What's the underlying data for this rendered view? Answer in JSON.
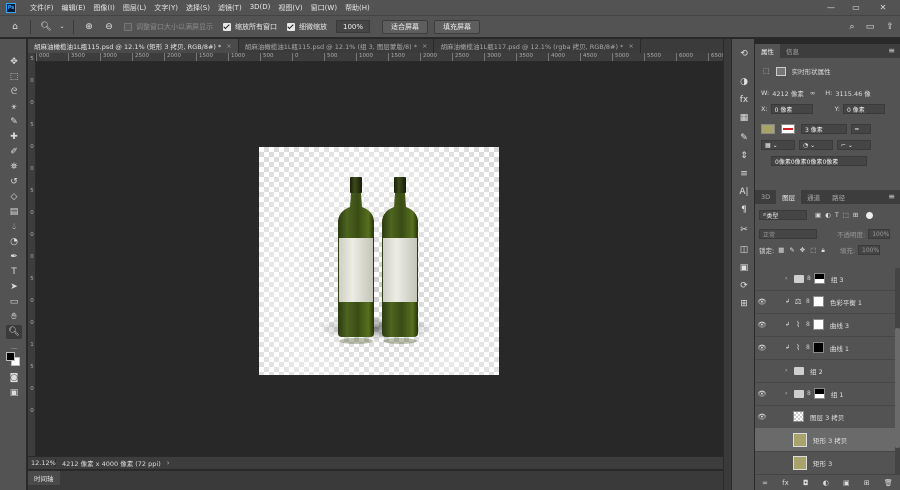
{
  "app": {
    "logo": "Ps"
  },
  "menu": [
    "文件(F)",
    "编辑(E)",
    "图像(I)",
    "图层(L)",
    "文字(Y)",
    "选择(S)",
    "滤镜(T)",
    "3D(D)",
    "视图(V)",
    "窗口(W)",
    "帮助(H)"
  ],
  "window_controls": {
    "minimize": "—",
    "maximize": "▭",
    "close": "✕"
  },
  "options": {
    "resize_windows": {
      "label": "调整窗口大小以满屏显示",
      "checked": false
    },
    "zoom_all": {
      "label": "缩放所有窗口",
      "checked": true
    },
    "scrubby_zoom": {
      "label": "细微缩放",
      "checked": true
    },
    "zoom_value": "100%",
    "fit_screen": "适合屏幕",
    "fill_screen": "填充屏幕"
  },
  "tabs": [
    {
      "label": "胡麻油橄榄油1L瓶115.psd @ 12.1% (矩形 3 拷贝, RGB/8#) *",
      "active": true
    },
    {
      "label": "胡麻油橄榄油1L瓶115.psd @ 12.1% (组 3, 图层蒙版/8) *",
      "active": false
    },
    {
      "label": "胡麻油橄榄油1L瓶117.psd @ 12.1% (rgba 拷贝, RGB/8#) *",
      "active": false
    }
  ],
  "ruler_top": [
    "000",
    "3500",
    "3000",
    "2500",
    "2000",
    "1500",
    "1000",
    "500",
    "0",
    "500",
    "1000",
    "1500",
    "2000",
    "2500",
    "3000",
    "3500",
    "4000",
    "4500",
    "5000",
    "5500",
    "6000",
    "6500",
    "7000",
    "7500"
  ],
  "ruler_left": [
    "5",
    "0",
    "0",
    "5",
    "0",
    "0",
    "5",
    "0",
    "0",
    "0",
    "5",
    "0",
    "0",
    "1",
    "5",
    "0",
    "0"
  ],
  "status": {
    "zoom": "12.12%",
    "info": "4212 像素 x 4000 像素 (72 ppi)",
    "arrow": "›"
  },
  "timeline": {
    "label": "时间轴"
  },
  "properties": {
    "tabs": [
      "属性",
      "信息"
    ],
    "title": "实时形状属性",
    "w_label": "W:",
    "w_value": "4212 像素",
    "h_label": "H:",
    "h_value": "3115.46 像",
    "x_label": "X:",
    "x_value": "0 像素",
    "y_label": "Y:",
    "y_value": "0 像素",
    "stroke_width": "3 像素",
    "corner": "0像素0像素0像素0像素",
    "fill_color": "#a8a36a",
    "stroke_color": "#cc2222"
  },
  "layers_panel": {
    "tabs": [
      "3D",
      "图层",
      "通道",
      "路径"
    ],
    "filter_label": "类型",
    "blend_mode": "正常",
    "opacity_label": "不透明度:",
    "opacity_value": "100%",
    "lock_label": "锁定:",
    "fill_label": "填充:",
    "fill_value": "100%",
    "layers": [
      {
        "name": "组 3",
        "kind": "group-mask",
        "visible": false,
        "selected": false
      },
      {
        "name": "色彩平衡 1",
        "kind": "balance",
        "visible": true,
        "selected": false
      },
      {
        "name": "曲线 3",
        "kind": "curves-white",
        "visible": true,
        "selected": false
      },
      {
        "name": "曲线 1",
        "kind": "curves-black",
        "visible": true,
        "selected": false
      },
      {
        "name": "组 2",
        "kind": "group",
        "visible": false,
        "selected": false
      },
      {
        "name": "组 1",
        "kind": "group-mask",
        "visible": true,
        "selected": false
      },
      {
        "name": "图层 3 拷贝",
        "kind": "layer",
        "visible": true,
        "selected": false
      },
      {
        "name": "矩形 3 拷贝",
        "kind": "shape",
        "visible": false,
        "selected": true
      },
      {
        "name": "矩形 3",
        "kind": "shape",
        "visible": false,
        "selected": false
      }
    ],
    "footer": [
      "∞",
      "fx",
      "◘",
      "◐",
      "▣",
      "⊞",
      "🗑"
    ]
  }
}
